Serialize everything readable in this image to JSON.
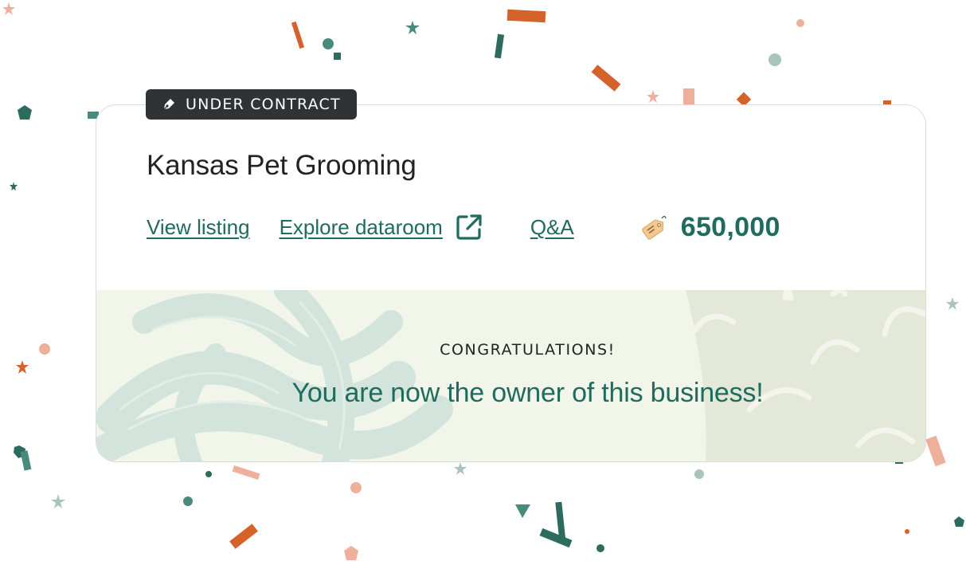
{
  "badge": {
    "label": "UNDER CONTRACT",
    "icon": "pen-nib-icon"
  },
  "business": {
    "name": "Kansas Pet Grooming"
  },
  "links": {
    "view_listing": "View listing",
    "explore_dataroom": "Explore dataroom",
    "external_icon": "external-link-icon",
    "qa": "Q&A"
  },
  "price": {
    "icon": "price-tag-icon",
    "value": "650,000"
  },
  "congrats": {
    "label": "CONGRATULATIONS!",
    "message": "You are now the owner of this business!"
  },
  "colors": {
    "accent": "#1f6b5e",
    "badge_bg": "#2f3336",
    "congrats_bg": "#f2f5ea",
    "confetti_orange": "#d4622a",
    "confetti_teal": "#2e6b5f",
    "confetti_peach": "#eeb09a",
    "confetti_sage": "#a7c4bd"
  }
}
